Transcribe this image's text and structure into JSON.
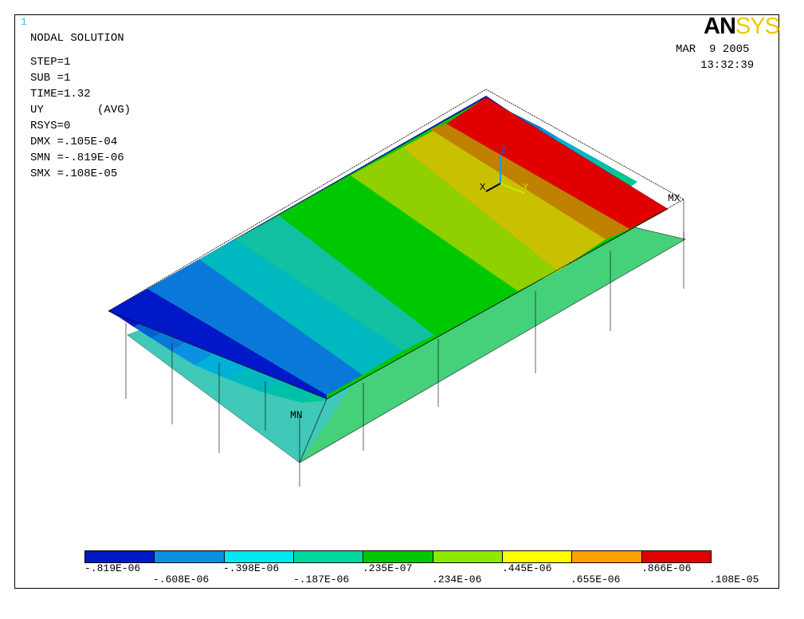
{
  "window": {
    "number": "1"
  },
  "logo": {
    "part1": "AN",
    "part2": "SYS"
  },
  "header": {
    "date": "MAR  9 2005",
    "time": "13:32:39"
  },
  "info": {
    "title": "NODAL SOLUTION",
    "lines": [
      "STEP=1",
      "SUB =1",
      "TIME=1.32",
      "UY        (AVG)",
      "RSYS=0",
      "DMX =.105E-04",
      "SMN =-.819E-06",
      "SMX =.108E-05"
    ]
  },
  "markers": {
    "max": "MX",
    "min": "MN"
  },
  "triad": {
    "x": "X",
    "y": "Y",
    "z": "Z"
  },
  "legend": {
    "colors": [
      "#0018c8",
      "#0a90e0",
      "#00e8f0",
      "#00d8a0",
      "#00c800",
      "#90e800",
      "#ffff00",
      "#ffa000",
      "#e00000"
    ],
    "top_labels": [
      "-.819E-06",
      "-.398E-06",
      ".235E-07",
      ".445E-06",
      ".866E-06"
    ],
    "bottom_labels": [
      "-.608E-06",
      "-.187E-06",
      ".234E-06",
      ".655E-06",
      ".108E-05"
    ]
  }
}
